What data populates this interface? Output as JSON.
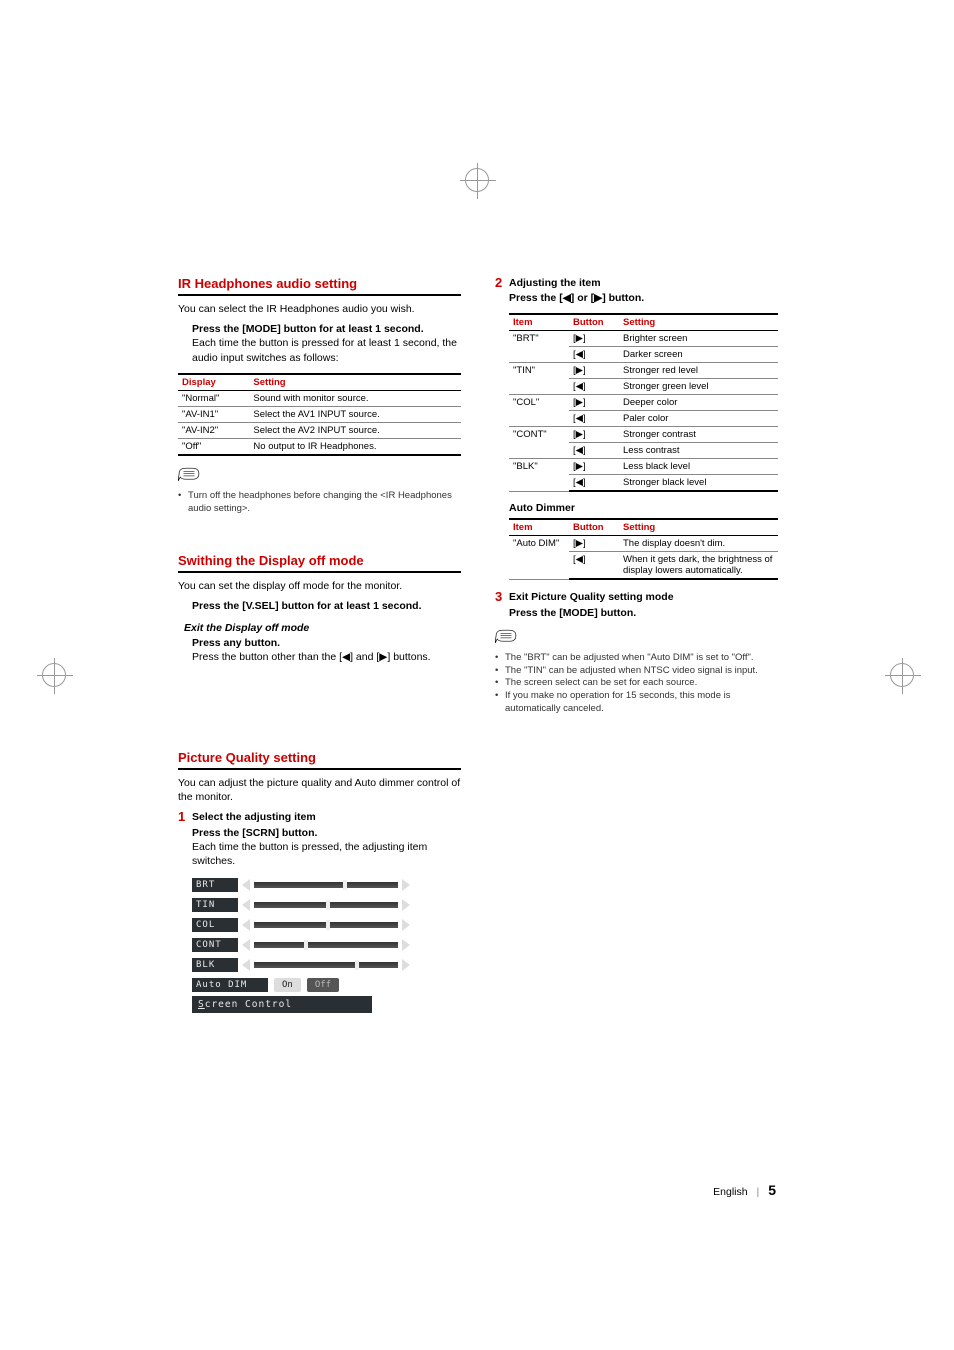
{
  "left": {
    "ir": {
      "title": "IR Headphones audio setting",
      "intro": "You can select the IR Headphones audio you wish.",
      "action_bold": "Press the [MODE] button for at least 1 second.",
      "action_text": "Each time the button is pressed for at least 1 second, the audio input switches as follows:",
      "table": {
        "headers": {
          "h1": "Display",
          "h2": "Setting"
        },
        "rows": [
          {
            "display": "\"Normal\"",
            "setting": "Sound with monitor source."
          },
          {
            "display": "\"AV-IN1\"",
            "setting": "Select the AV1 INPUT source."
          },
          {
            "display": "\"AV-IN2\"",
            "setting": "Select the AV2 INPUT source."
          },
          {
            "display": "\"Off\"",
            "setting": "No output to IR Headphones."
          }
        ]
      },
      "note": "Turn off the headphones before changing the <IR Headphones audio setting>."
    },
    "switch": {
      "title": "Swithing the Display off mode",
      "intro": "You can set the display off mode for the monitor.",
      "action_bold": "Press the [V.SEL] button for at least 1 second.",
      "exit_head": "Exit the Display off mode",
      "exit_bold": "Press any button.",
      "exit_text_a": "Press the button other than the [",
      "exit_text_b": "] and [",
      "exit_text_c": "] buttons."
    },
    "picture": {
      "title": "Picture Quality setting",
      "intro": "You can adjust the picture quality and Auto dimmer control of the monitor.",
      "step1_num": "1",
      "step1_head": "Select the adjusting item",
      "step1_bold": "Press the [SCRN] button.",
      "step1_text": "Each time the button is pressed, the adjusting item switches.",
      "screen": {
        "brt": "BRT",
        "tin": "TIN",
        "col": "COL",
        "cont": "CONT",
        "blk": "BLK",
        "auto": "Auto DIM",
        "on": "On",
        "off": "Off",
        "title_a": "S",
        "title_b": "creen Control"
      }
    }
  },
  "right": {
    "step2_num": "2",
    "step2_head": "Adjusting the item",
    "step2_bold_a": "Press the [",
    "step2_bold_b": "] or [",
    "step2_bold_c": "] button.",
    "table1": {
      "headers": {
        "h1": "Item",
        "h2": "Button",
        "h3": "Setting"
      },
      "rows": [
        {
          "item": "\"BRT\"",
          "btn1": "▶",
          "set1": "Brighter screen",
          "btn2": "◀",
          "set2": "Darker screen"
        },
        {
          "item": "\"TIN\"",
          "btn1": "▶",
          "set1": "Stronger red level",
          "btn2": "◀",
          "set2": "Stronger green level"
        },
        {
          "item": "\"COL\"",
          "btn1": "▶",
          "set1": "Deeper color",
          "btn2": "◀",
          "set2": "Paler color"
        },
        {
          "item": "\"CONT\"",
          "btn1": "▶",
          "set1": "Stronger contrast",
          "btn2": "◀",
          "set2": "Less contrast"
        },
        {
          "item": "\"BLK\"",
          "btn1": "▶",
          "set1": "Less black level",
          "btn2": "◀",
          "set2": "Stronger black level"
        }
      ]
    },
    "autodimmer_head": "Auto Dimmer",
    "table2": {
      "headers": {
        "h1": "Item",
        "h2": "Button",
        "h3": "Setting"
      },
      "row": {
        "item": "\"Auto DIM\"",
        "btn1": "▶",
        "set1": "The display doesn't dim.",
        "btn2": "◀",
        "set2": "When it gets dark, the brightness of display lowers automatically."
      }
    },
    "step3_num": "3",
    "step3_head": "Exit Picture Quality setting mode",
    "step3_bold": "Press the [MODE] button.",
    "notes": [
      "The \"BRT\" can be adjusted when \"Auto DIM\" is set to \"Off\".",
      "The \"TIN\" can be adjusted when NTSC video signal is input.",
      "The screen select can be set for each source.",
      "If you make no operation for 15 seconds, this mode is automatically canceled."
    ]
  },
  "footer": {
    "lang": "English",
    "page": "5"
  },
  "glyphs": {
    "tri_left": "◀",
    "tri_right": "▶",
    "bracket_l": "[",
    "bracket_r": "]",
    "bullet": "•"
  }
}
